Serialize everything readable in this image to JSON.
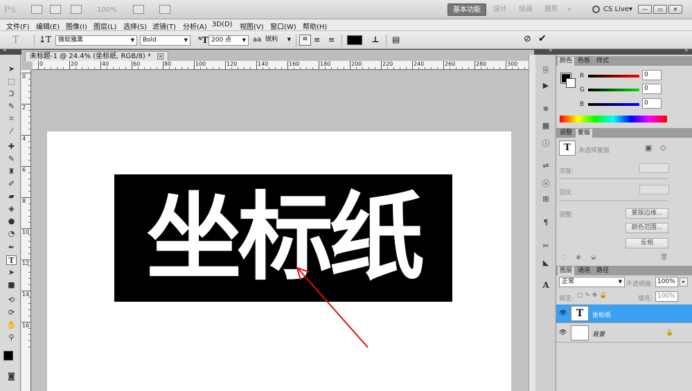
{
  "appbar": {
    "logo": "Ps",
    "zoom": "100%",
    "workspaces": [
      "基本功能",
      "设计",
      "绘画",
      "摄影",
      "»"
    ],
    "cs_live": "CS Live▾",
    "window_buttons": [
      "—",
      "▭",
      "✕"
    ]
  },
  "menubar": {
    "items": [
      "文件(F)",
      "编辑(E)",
      "图像(I)",
      "图层(L)",
      "选择(S)",
      "滤镜(T)",
      "分析(A)",
      "3D(D)",
      "视图(V)",
      "窗口(W)",
      "帮助(H)"
    ]
  },
  "options": {
    "tool_glyph": "T",
    "font_family": "微软雅黑",
    "font_style": "Bold",
    "font_size": "200 点",
    "aa_label": "aa",
    "antialias": "锐利",
    "text_color": "#000000"
  },
  "document": {
    "tab_title": "未标题-1 @ 24.4% (坐标纸, RGB/8) *",
    "tab_close": "✕",
    "ruler_h": [
      "0",
      "20",
      "40",
      "60",
      "80",
      "100",
      "120",
      "140",
      "160",
      "180",
      "200",
      "220",
      "240",
      "260",
      "280",
      "300"
    ],
    "ruler_v": [
      "0",
      "2",
      "4",
      "6",
      "8",
      "10",
      "12",
      "14",
      "16"
    ],
    "text_content": "坐标纸"
  },
  "color_panel": {
    "tabs": [
      "颜色",
      "色板",
      "样式"
    ],
    "channels": [
      {
        "label": "R",
        "value": "0",
        "color": "#cc1010"
      },
      {
        "label": "G",
        "value": "0",
        "color": "#15b015"
      },
      {
        "label": "B",
        "value": "0",
        "color": "#1010cc"
      }
    ]
  },
  "mask_panel": {
    "tabs": [
      "调整",
      "蒙版"
    ],
    "no_selection": "未选择蒙版",
    "density_label": "浓度:",
    "feather_label": "羽化:",
    "refine_label": "调整:",
    "buttons": [
      "蒙版边缘...",
      "颜色范围...",
      "反相"
    ]
  },
  "layers_panel": {
    "tabs": [
      "图层",
      "通道",
      "路径"
    ],
    "blend_mode": "正常",
    "opacity_label": "不透明度:",
    "opacity": "100%",
    "lock_label": "锁定:",
    "fill_label": "填充:",
    "fill": "100%",
    "layers": [
      {
        "name": "坐标纸",
        "thumb": "T",
        "selected": true
      },
      {
        "name": "背景",
        "thumb": "",
        "selected": false
      }
    ]
  },
  "colors": {
    "accent": "#3aa0f0",
    "workspace_active": "#767676",
    "arrow": "#e01010"
  }
}
